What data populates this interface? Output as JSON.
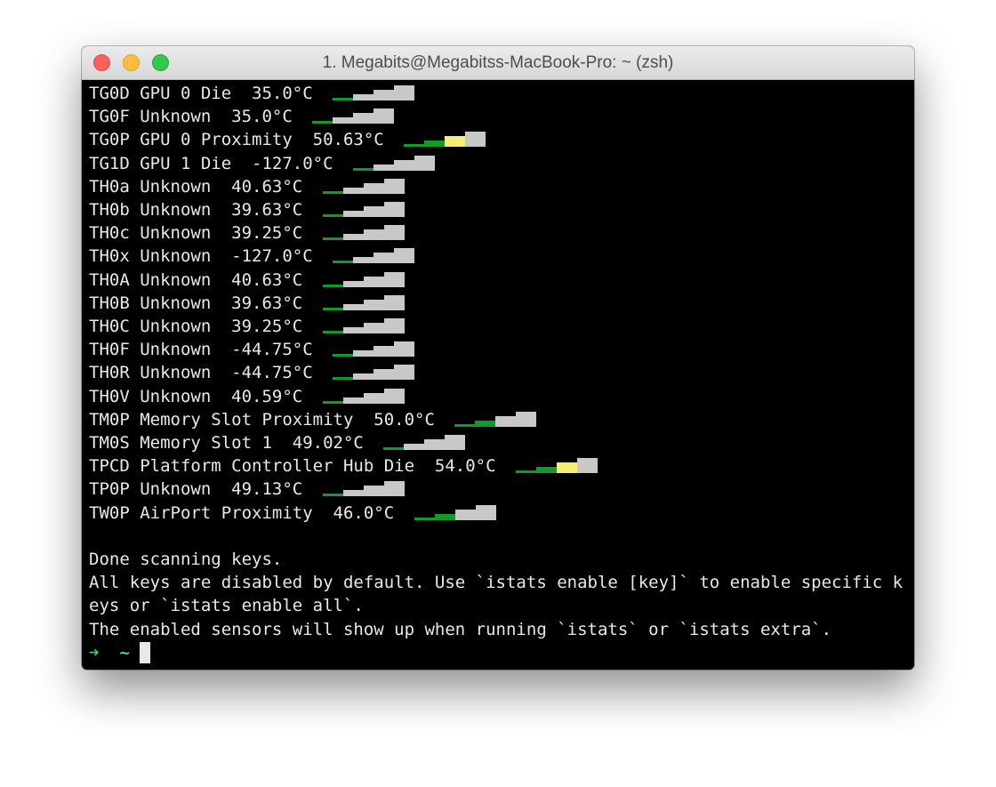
{
  "window": {
    "title": "1. Megabits@Megabitss-MacBook-Pro: ~ (zsh)"
  },
  "colors": {
    "green": "#0f9a2b",
    "yellow": "#f5ef78",
    "gray": "#c8c8c8",
    "prompt_arrow": "#3fd15a",
    "prompt_dir": "#45c9c9"
  },
  "sensors": [
    {
      "text": "TG0D GPU 0 Die  35.0°C ",
      "level": 1
    },
    {
      "text": "TG0F Unknown  35.0°C ",
      "level": 1
    },
    {
      "text": "TG0P GPU 0 Proximity  50.63°C ",
      "level": 3
    },
    {
      "text": "TG1D GPU 1 Die  -127.0°C ",
      "level": 1
    },
    {
      "text": "TH0a Unknown  40.63°C ",
      "level": 1
    },
    {
      "text": "TH0b Unknown  39.63°C ",
      "level": 1
    },
    {
      "text": "TH0c Unknown  39.25°C ",
      "level": 1
    },
    {
      "text": "TH0x Unknown  -127.0°C ",
      "level": 1
    },
    {
      "text": "TH0A Unknown  40.63°C ",
      "level": 1
    },
    {
      "text": "TH0B Unknown  39.63°C ",
      "level": 1
    },
    {
      "text": "TH0C Unknown  39.25°C ",
      "level": 1
    },
    {
      "text": "TH0F Unknown  -44.75°C ",
      "level": 1
    },
    {
      "text": "TH0R Unknown  -44.75°C ",
      "level": 1
    },
    {
      "text": "TH0V Unknown  40.59°C ",
      "level": 1
    },
    {
      "text": "TM0P Memory Slot Proximity  50.0°C ",
      "level": 2
    },
    {
      "text": "TM0S Memory Slot 1  49.02°C ",
      "level": 1
    },
    {
      "text": "TPCD Platform Controller Hub Die  54.0°C ",
      "level": 3
    },
    {
      "text": "TP0P Unknown  49.13°C ",
      "level": 1
    },
    {
      "text": "TW0P AirPort Proximity  46.0°C ",
      "level": 2
    }
  ],
  "messages": [
    "",
    "Done scanning keys.",
    "All keys are disabled by default. Use `istats enable [key]` to enable specific k",
    "eys or `istats enable all`.",
    "The enabled sensors will show up when running `istats` or `istats extra`."
  ],
  "prompt": {
    "arrow": "➜",
    "dir": "~"
  }
}
